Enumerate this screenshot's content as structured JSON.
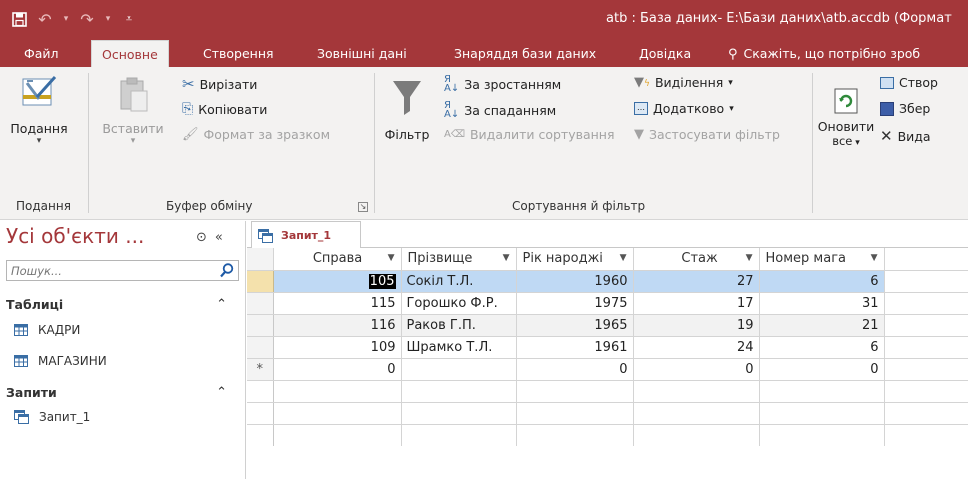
{
  "window": {
    "title": "atb : База даних- E:\\Бази даних\\atb.accdb (Формат"
  },
  "tabs": {
    "file": "Файл",
    "home": "Основне",
    "create": "Створення",
    "external": "Зовнішні дані",
    "tools": "Знаряддя бази даних",
    "help": "Довідка",
    "tell_me": "Скажіть, що потрібно зроб"
  },
  "ribbon": {
    "views": {
      "button": "Подання",
      "group": "Подання"
    },
    "clipboard": {
      "paste": "Вставити",
      "cut": "Вирізати",
      "copy": "Копіювати",
      "format_painter": "Формат за зразком",
      "group": "Буфер обміну"
    },
    "sort_filter": {
      "filter": "Фільтр",
      "ascending": "За зростанням",
      "descending": "За спаданням",
      "remove_sort": "Видалити сортування",
      "selection": "Виділення",
      "advanced": "Додатково",
      "toggle_filter": "Застосувати фільтр",
      "group": "Сортування й фільтр"
    },
    "records": {
      "refresh_line1": "Оновити",
      "refresh_line2": "все",
      "new": "Створ",
      "save": "Збер",
      "delete": "Вида"
    }
  },
  "nav": {
    "header": "Усі об'єкти ...",
    "search_placeholder": "Пошук...",
    "sections": [
      {
        "label": "Таблиці",
        "items": [
          "КАДРИ",
          "МАГАЗИНИ"
        ]
      },
      {
        "label": "Запити",
        "items": [
          "Запит_1"
        ]
      }
    ]
  },
  "document": {
    "tab_label": "Запит_1",
    "columns": [
      "Справа",
      "Прізвище",
      "Рік народжі",
      "Стаж",
      "Номер мага"
    ],
    "rows": [
      [
        "105",
        "Сокіл Т.Л.",
        "1960",
        "27",
        "6"
      ],
      [
        "115",
        "Горошко Ф.Р.",
        "1975",
        "17",
        "31"
      ],
      [
        "116",
        "Раков Г.П.",
        "1965",
        "19",
        "21"
      ],
      [
        "109",
        "Шрамко Т.Л.",
        "1961",
        "24",
        "6"
      ]
    ],
    "new_row": [
      "0",
      "",
      "0",
      "0",
      "0"
    ],
    "new_row_marker": "*"
  },
  "colors": {
    "accent": "#a4373a",
    "current_row": "#bfd9f4",
    "selector": "#f4e1ac"
  }
}
